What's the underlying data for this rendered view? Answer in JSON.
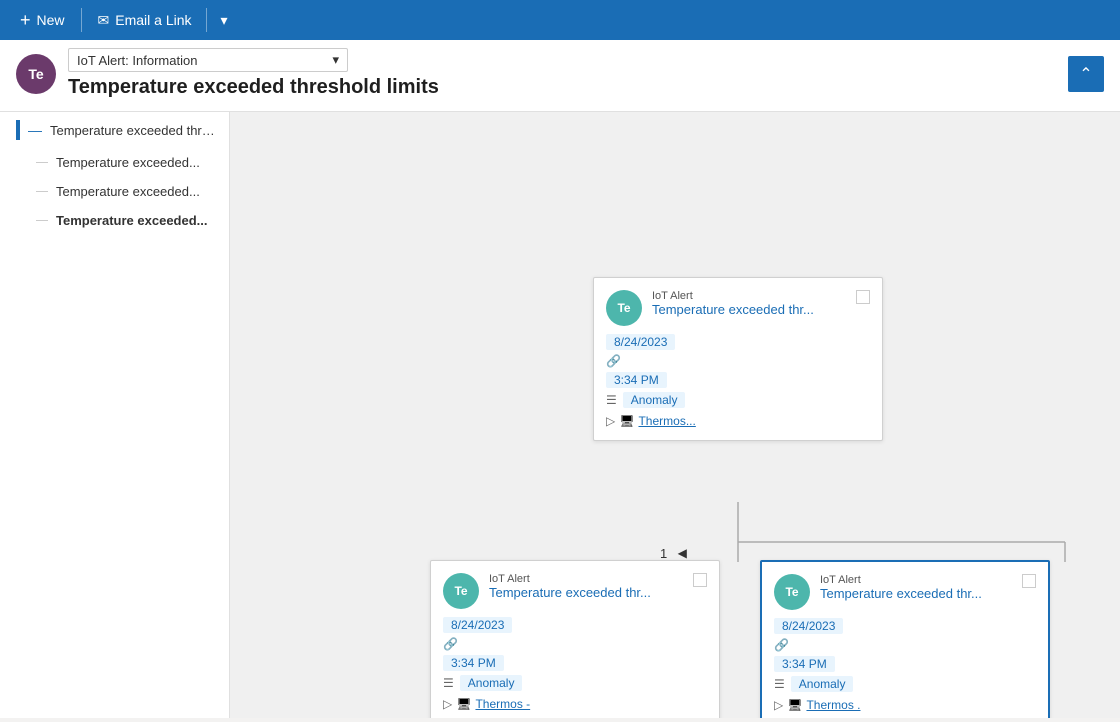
{
  "toolbar": {
    "new_label": "New",
    "email_label": "Email a Link",
    "new_icon": "+",
    "email_icon": "✉",
    "chevron_icon": "▾"
  },
  "header": {
    "avatar_initials": "Te",
    "dropdown_label": "IoT Alert: Information",
    "title": "Temperature exceeded threshold limits",
    "collapse_icon": "⌃"
  },
  "sidebar": {
    "root_item": "Temperature exceeded thresh...",
    "children": [
      {
        "label": "Temperature exceeded...",
        "selected": false
      },
      {
        "label": "Temperature exceeded...",
        "selected": false
      },
      {
        "label": "Temperature exceeded...",
        "selected": true
      }
    ]
  },
  "cards": {
    "top": {
      "avatar": "Te",
      "type": "IoT Alert",
      "title": "Temperature exceeded thr...",
      "date": "8/24/2023",
      "time": "3:34 PM",
      "category": "Anomaly",
      "link": "Thermos..."
    },
    "bottom_left": {
      "avatar": "Te",
      "type": "IoT Alert",
      "title": "Temperature exceeded thr...",
      "date": "8/24/2023",
      "time": "3:34 PM",
      "category": "Anomaly",
      "link": "Thermos -"
    },
    "bottom_right": {
      "avatar": "Te",
      "type": "IoT Alert",
      "title": "Temperature exceeded thr...",
      "date": "8/24/2023",
      "time": "3:34 PM",
      "category": "Anomaly",
      "link": "Thermos ."
    }
  },
  "pagination": {
    "page": "1",
    "prev_icon": "◀"
  }
}
